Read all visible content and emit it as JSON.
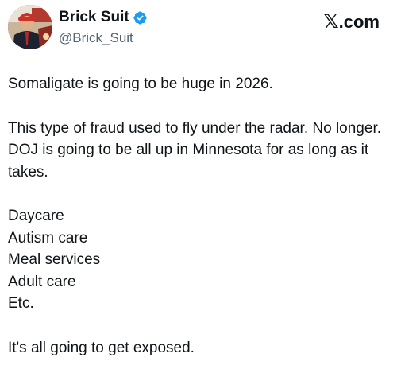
{
  "author": {
    "display_name": "Brick Suit",
    "handle": "@Brick_Suit",
    "verified": true,
    "verified_color": "#1d9bf0"
  },
  "brand": {
    "mark": "𝕏",
    "suffix": ".com"
  },
  "tweet": {
    "line1": "Somaligate is going to be huge in 2026.",
    "line2": "This type of fraud used to fly under the radar. No longer. DOJ is going to be all up in Minnesota for as long as it takes.",
    "list": [
      "Daycare",
      "Autism care",
      "Meal services",
      "Adult care",
      "Etc."
    ],
    "closing": "It's all going to get exposed."
  },
  "icons": {
    "avatar": "avatar-image",
    "verified": "verified-badge-icon"
  }
}
